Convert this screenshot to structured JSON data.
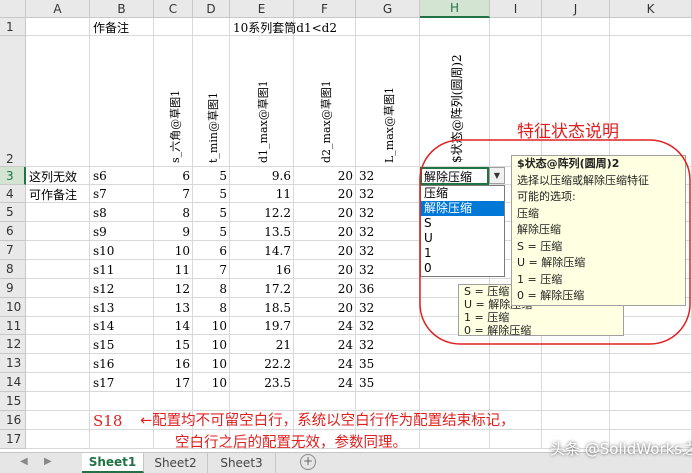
{
  "columns": [
    "A",
    "B",
    "C",
    "D",
    "E",
    "F",
    "G",
    "H",
    "I",
    "J",
    "K"
  ],
  "rows": [
    "1",
    "2",
    "3",
    "4",
    "5",
    "6",
    "7",
    "8",
    "9",
    "10",
    "11",
    "12",
    "13",
    "14",
    "15",
    "16",
    "17"
  ],
  "row1": {
    "b": "作备注",
    "e": "10系列套筒d1<d2"
  },
  "headers_vertical": {
    "c": "s_六角@草图1",
    "d": "t_min@草图1",
    "e": "d1_max@草图1",
    "f": "d2_max@草图1",
    "g": "L_max@草图1",
    "h": "$状态@阵列(圆周)2"
  },
  "notes": {
    "a3": "这列无效",
    "a4": "可作备注"
  },
  "table": [
    {
      "b": "s6",
      "c": "6",
      "d": "5",
      "e": "9.6",
      "f": "20",
      "g": "32",
      "h": "解除压缩"
    },
    {
      "b": "s7",
      "c": "7",
      "d": "5",
      "e": "11",
      "f": "20",
      "g": "32"
    },
    {
      "b": "s8",
      "c": "8",
      "d": "5",
      "e": "12.2",
      "f": "20",
      "g": "32"
    },
    {
      "b": "s9",
      "c": "9",
      "d": "5",
      "e": "13.5",
      "f": "20",
      "g": "32"
    },
    {
      "b": "s10",
      "c": "10",
      "d": "6",
      "e": "14.7",
      "f": "20",
      "g": "32"
    },
    {
      "b": "s11",
      "c": "11",
      "d": "7",
      "e": "16",
      "f": "20",
      "g": "32"
    },
    {
      "b": "s12",
      "c": "12",
      "d": "8",
      "e": "17.2",
      "f": "20",
      "g": "36"
    },
    {
      "b": "s13",
      "c": "13",
      "d": "8",
      "e": "18.5",
      "f": "20",
      "g": "32"
    },
    {
      "b": "s14",
      "c": "14",
      "d": "10",
      "e": "19.7",
      "f": "24",
      "g": "32"
    },
    {
      "b": "s15",
      "c": "15",
      "d": "10",
      "e": "21",
      "f": "24",
      "g": "32"
    },
    {
      "b": "s16",
      "c": "16",
      "d": "10",
      "e": "22.2",
      "f": "24",
      "g": "35"
    },
    {
      "b": "s17",
      "c": "17",
      "d": "10",
      "e": "23.5",
      "f": "24",
      "g": "35"
    }
  ],
  "dropdown": {
    "selected": "解除压缩",
    "options": [
      "压缩",
      "解除压缩",
      "S",
      "U",
      "1",
      "0"
    ],
    "highlighted": "解除压缩"
  },
  "tooltip": {
    "title": "$状态@阵列(圆周)2",
    "lines": [
      "选择以压缩或解除压缩特征",
      "可能的选项:",
      "压缩",
      "解除压缩",
      "S = 压缩",
      "U = 解除压缩",
      "1 = 压缩",
      "0 = 解除压缩"
    ]
  },
  "tooltip_shadow": [
    "S = 压缩",
    "U = 解除压缩",
    "1 = 压缩",
    "0 = 解除压缩"
  ],
  "annotation_title": "特征状态说明",
  "s18": "S18",
  "note_line1": "←配置均不可留空白行，系统以空白行作为配置结束标记，",
  "note_line2": "空白行之后的配置无效，参数同理。",
  "sheets": [
    "Sheet1",
    "Sheet2",
    "Sheet3"
  ],
  "active_sheet": "Sheet1",
  "add_sheet": "+",
  "watermark": "头条 @SolidWorks之道",
  "colors": {
    "accent": "#217346",
    "annotation_red": "#e02020",
    "tooltip_bg": "#ffffe1"
  }
}
